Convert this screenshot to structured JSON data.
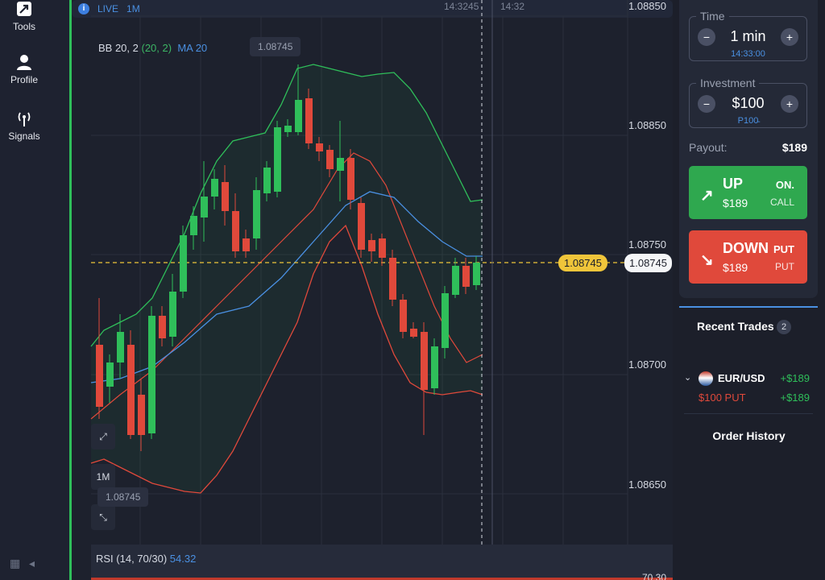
{
  "sidebar": {
    "items": [
      {
        "label": "Tools",
        "icon": "trend-arrow-icon"
      },
      {
        "label": "Profile",
        "icon": "user-icon"
      },
      {
        "label": "Signals",
        "icon": "signal-icon"
      }
    ]
  },
  "chart": {
    "live_label": "LIVE",
    "timeframe_label": "1M",
    "indicator": {
      "bb": "BB 20, 2",
      "bb_params": "(20, 2)",
      "ma": "MA 20"
    },
    "hover_price": "1.08745",
    "time_labels": [
      "14:3245",
      "14:32"
    ],
    "price_ticks": [
      "1.08850",
      "1.08850",
      "1.08750",
      "1.08700",
      "1.08650"
    ],
    "current_price": "1.08745",
    "current_price_right": "1.08745",
    "tool_timeframe": "1M",
    "bottom_price_label": "1.08745",
    "rsi": {
      "label": "RSI (14, 70/30)",
      "value": "54.32",
      "tick": "70.30"
    }
  },
  "panel": {
    "time": {
      "legend": "Time",
      "value": "1 min",
      "sub": "14:33:00"
    },
    "investment": {
      "legend": "Investment",
      "value": "$100",
      "sub": "P100̵"
    },
    "payout_label": "Payout:",
    "payout_value": "$189",
    "up": {
      "main": "UP",
      "amount": "$189",
      "tag1": "ON.",
      "tag2": "CALL"
    },
    "down": {
      "main": "DOWN",
      "amount": "$189",
      "tag1": "PUT",
      "tag2": "PUT"
    },
    "recent_title": "Recent Trades",
    "recent_count": "2",
    "trade": {
      "pair": "EUR/USD",
      "pnl": "+$189",
      "sub": "$100 PUT",
      "pnl2": "+$189"
    },
    "order_history": "Order History"
  },
  "colors": {
    "up": "#2fa84f",
    "down": "#e0493b",
    "accent": "#4a90e2",
    "current": "#f0c53a"
  }
}
